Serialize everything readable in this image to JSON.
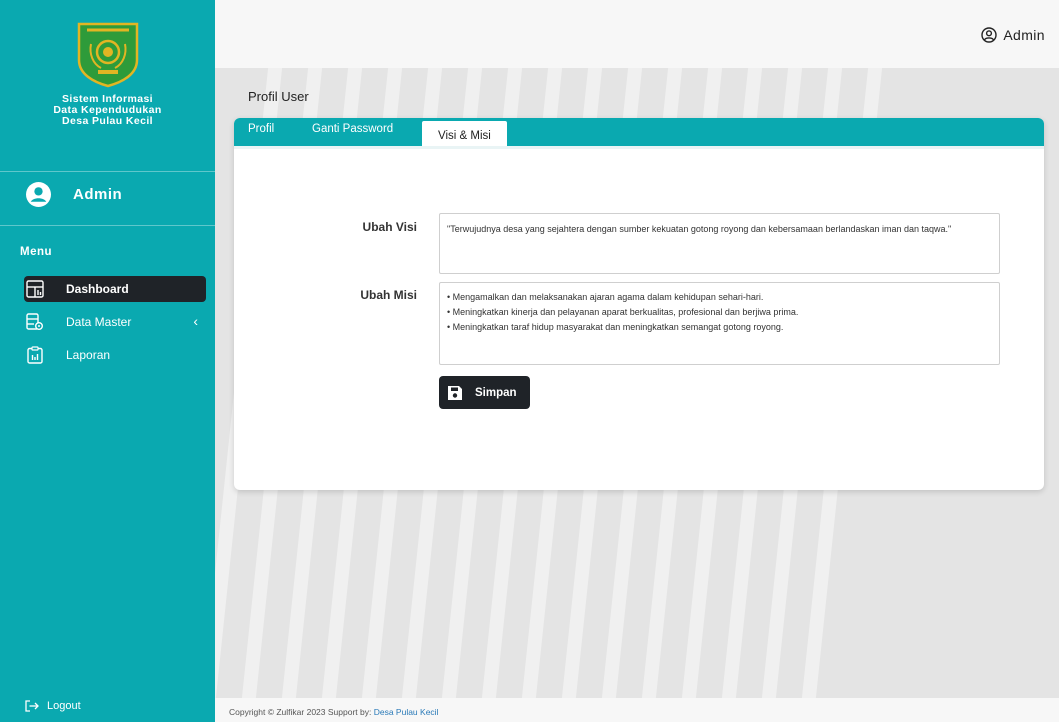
{
  "sidebar": {
    "app_title_line1": "Sistem Informasi",
    "app_title_line2": "Data Kependudukan",
    "app_title_line3": "Desa Pulau Kecil",
    "user_name": "Admin",
    "menu_label": "Menu",
    "items": [
      {
        "label": "Dashboard",
        "icon": "dashboard-icon",
        "active": true
      },
      {
        "label": "Data Master",
        "icon": "data-master-icon",
        "active": false
      },
      {
        "label": "Laporan",
        "icon": "report-icon",
        "active": false
      }
    ],
    "logout_label": "Logout"
  },
  "header": {
    "user_label": "Admin"
  },
  "page": {
    "title": "Profil User",
    "tabs": [
      {
        "label": "Profil",
        "active": false
      },
      {
        "label": "Ganti Password",
        "active": false
      },
      {
        "label": "Visi & Misi",
        "active": true
      }
    ],
    "form": {
      "visi_label": "Ubah Visi",
      "visi_value": "\"Terwujudnya desa yang sejahtera dengan sumber kekuatan gotong royong dan kebersamaan berlandaskan iman dan taqwa.\"",
      "misi_label": "Ubah Misi",
      "misi_items": [
        "• Mengamalkan dan melaksanakan ajaran agama dalam kehidupan sehari-hari.",
        "• Meningkatkan kinerja dan pelayanan aparat berkualitas, profesional dan berjiwa prima.",
        "• Meningkatkan taraf hidup masyarakat dan meningkatkan semangat gotong royong."
      ],
      "save_label": "Simpan"
    }
  },
  "footer": {
    "text": "Copyright © Zulfikar 2023 Support by:",
    "link": "Desa Pulau Kecil"
  },
  "colors": {
    "accent": "#0aa9b0",
    "dark": "#1f2328",
    "logo_green": "#2e9b3a",
    "logo_gold": "#e2b523"
  }
}
